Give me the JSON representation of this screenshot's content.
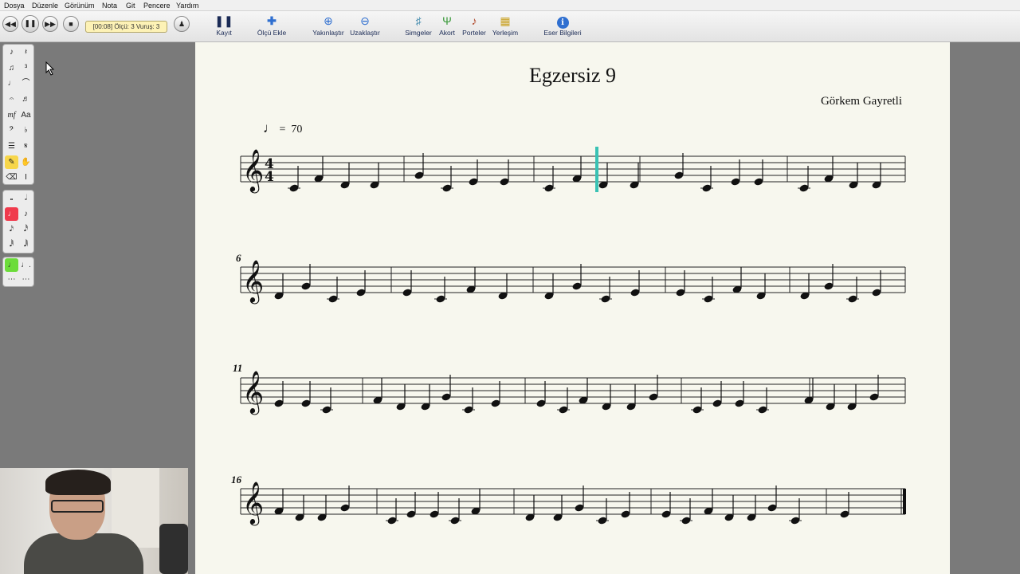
{
  "menu": [
    "Dosya",
    "Düzenle",
    "Görünüm",
    "Nota",
    "Git",
    "Pencere",
    "Yardım"
  ],
  "transport": {
    "counter": "[00:08]  Ölçü: 3  Vuruş: 3"
  },
  "toolbar": {
    "kayit": "Kayıt",
    "olcu_ekle": "Ölçü Ekle",
    "yakinlastir": "Yakınlaştır",
    "uzaklastir": "Uzaklaştır",
    "simgeler": "Simgeler",
    "akort": "Akort",
    "porteler": "Porteler",
    "yerlesim": "Yerleşim",
    "eser_bilgileri": "Eser Bilgileri"
  },
  "score": {
    "title": "Egzersiz 9",
    "composer": "Görkem Gayretli",
    "tempo_value": "70",
    "tempo_eq": "=",
    "time_signature": "4/4",
    "measure_numbers": [
      "6",
      "11",
      "16"
    ]
  },
  "colors": {
    "playhead": "#39c2b4",
    "selected_tool": "#f7d64a",
    "selected_note": "#f03a4c",
    "selected_dot": "#6cdc3a"
  }
}
